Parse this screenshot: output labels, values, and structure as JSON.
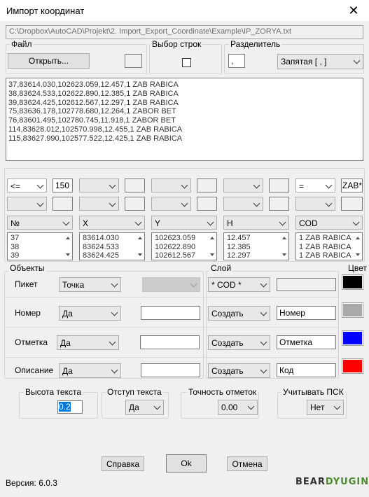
{
  "window": {
    "title": "Импорт координат",
    "close_glyph": "✕"
  },
  "path": "C:\\Dropbox\\AutoCAD\\Projekt\\2. Import_Export_Coordinate\\Example\\IP_ZORYA.txt",
  "file_group": {
    "label": "Файл",
    "open_button": "Открыть..."
  },
  "rows_group": {
    "label": "Выбор строк",
    "checked": false
  },
  "separator_group": {
    "label": "Разделитель",
    "custom_value": ",",
    "selected": "Запятая [ , ]"
  },
  "preview_lines": [
    "37,83614.030,102623.059,12.457,1 ZAB RABICA",
    "38,83624.533,102622.890,12.385,1 ZAB RABICA",
    "39,83624.425,102612.567,12.297,1 ZAB RABICA",
    "75,83636.178,102778.680,12.264,1 ZABOR BET",
    "76,83601.495,102780.745,11.918,1 ZABOR BET",
    "114,83628.012,102570.998,12.455,1 ZAB RABICA",
    "115,83627.990,102577.522,12.425,1 ZAB RABICA"
  ],
  "filters": {
    "row1": [
      {
        "op": "<=",
        "value": "150"
      },
      {
        "op": "",
        "value": ""
      },
      {
        "op": "",
        "value": ""
      },
      {
        "op": "",
        "value": ""
      },
      {
        "op": "=",
        "value": "ZAB*"
      }
    ],
    "row2": [
      {
        "op": "",
        "value": ""
      },
      {
        "op": "",
        "value": ""
      },
      {
        "op": "",
        "value": ""
      },
      {
        "op": "",
        "value": ""
      },
      {
        "op": "",
        "value": ""
      }
    ]
  },
  "columns": [
    {
      "header": "№",
      "values": [
        "37",
        "38",
        "39"
      ]
    },
    {
      "header": "X",
      "values": [
        "83614.030",
        "83624.533",
        "83624.425"
      ]
    },
    {
      "header": "Y",
      "values": [
        "102623.059",
        "102622.890",
        "102612.567"
      ]
    },
    {
      "header": "H",
      "values": [
        "12.457",
        "12.385",
        "12.297"
      ]
    },
    {
      "header": "COD",
      "values": [
        "1 ZAB RABICA",
        "1 ZAB RABICA",
        "1 ZAB RABICA"
      ]
    }
  ],
  "objects": {
    "label": "Объекты",
    "layer_label": "Слой",
    "color_label": "Цвет",
    "rows": [
      {
        "name": "Пикет",
        "type": "Точка",
        "extra": "",
        "layer_mode": "* COD *",
        "layer_name": "",
        "color": "#000000"
      },
      {
        "name": "Номер",
        "type": "Да",
        "extra": "",
        "layer_mode": "Создать",
        "layer_name": "Номер",
        "color": "#a9a9a9"
      },
      {
        "name": "Отметка",
        "type": "Да",
        "extra": "",
        "layer_mode": "Создать",
        "layer_name": "Отметка",
        "color": "#0000ff"
      },
      {
        "name": "Описание",
        "type": "Да",
        "extra": "",
        "layer_mode": "Создать",
        "layer_name": "Код",
        "color": "#ff0000"
      }
    ]
  },
  "settings": {
    "text_height": {
      "label": "Высота текста",
      "value": "0.2"
    },
    "text_offset": {
      "label": "Отступ текста",
      "value": "Да"
    },
    "precision": {
      "label": "Точность отметок",
      "value": "0.00"
    },
    "ucs": {
      "label": "Учитывать ПСК",
      "value": "Нет"
    }
  },
  "buttons": {
    "help": "Справка",
    "ok": "Ok",
    "cancel": "Отмена"
  },
  "footer": {
    "version": "Версия: 6.0.3",
    "logo_a": "BEAR",
    "logo_b": "DYUGIN"
  }
}
